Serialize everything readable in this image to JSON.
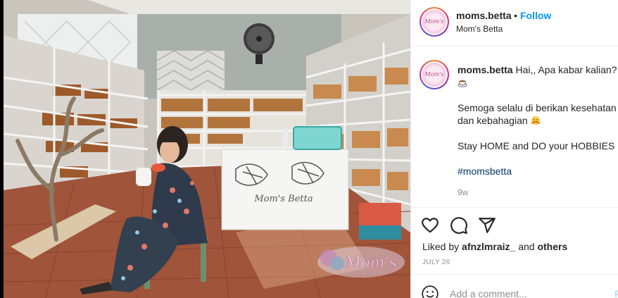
{
  "post": {
    "username": "moms.betta",
    "follow_label": "Follow",
    "separator": "•",
    "location": "Mom's Betta",
    "avatar_text": "Mom's",
    "photo_watermark": "Mom's",
    "photo_sign": "Mom's Betta"
  },
  "caption": {
    "username": "moms.betta",
    "line1": "Hai,, Apa kabar kalian?",
    "line2": "Semoga selalu di berikan kesehatan dan kebahagian",
    "line3": "Stay HOME and DO your HOBBIES",
    "hashtag": "#momsbetta",
    "time_ago": "9w"
  },
  "engagement": {
    "liked_prefix": "Liked by",
    "liked_user": "afnzlmraiz_",
    "liked_and": "and",
    "liked_others": "others",
    "date": "JULY 26"
  },
  "comment": {
    "placeholder": "Add a comment...",
    "post_label": "P"
  },
  "icons": {
    "like": "heart-icon",
    "comment": "comment-icon",
    "share": "share-icon",
    "emoji": "smiley-icon"
  },
  "colors": {
    "follow": "#0095f6",
    "text": "#262626",
    "muted": "#8e8e8e",
    "hashtag": "#00376b"
  }
}
